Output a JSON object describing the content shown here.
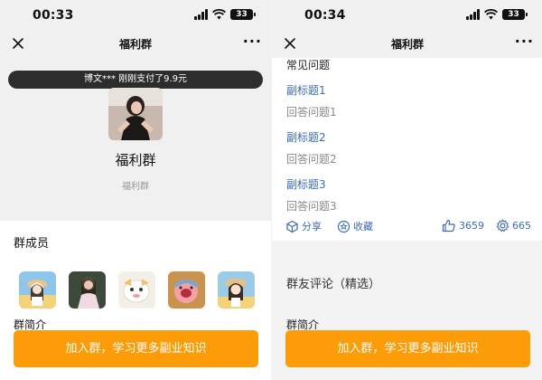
{
  "left": {
    "status": {
      "time": "00:33",
      "battery": "33"
    },
    "nav": {
      "title": "福利群"
    },
    "ticker": "博文*** 刚刚支付了9.9元",
    "group": {
      "name": "福利群",
      "subtitle": "福利群"
    },
    "members_title": "群成员",
    "intro_label": "群简介",
    "cta": "加入群，学习更多副业知识"
  },
  "right": {
    "status": {
      "time": "00:34",
      "battery": "33"
    },
    "nav": {
      "title": "福利群"
    },
    "faq": {
      "heading": "常见问题",
      "items": [
        {
          "q": "副标题1",
          "a": "回答问题1"
        },
        {
          "q": "副标题2",
          "a": "回答问题2"
        },
        {
          "q": "副标题3",
          "a": "回答问题3"
        }
      ]
    },
    "actions": {
      "share": "分享",
      "favorite": "收藏",
      "likes": "3659",
      "shares": "665"
    },
    "comments_title": "群友评论（精选）",
    "intro_label": "群简介",
    "cta": "加入群，学习更多副业知识"
  },
  "colors": {
    "accent": "#fb9c08",
    "link": "#3c6bb0",
    "ticker_bg": "#2d2d2d"
  }
}
